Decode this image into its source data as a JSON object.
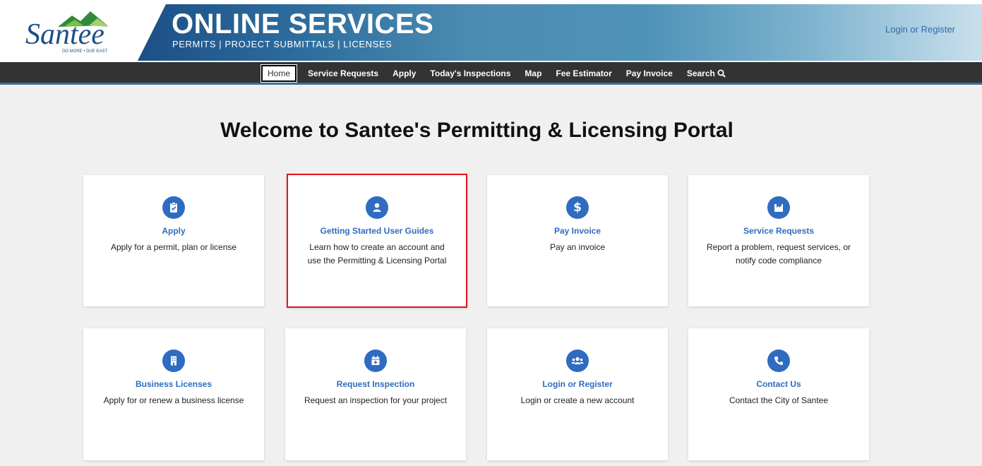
{
  "header": {
    "logo_text": "Santee",
    "logo_tagline": "DO MORE • DUE EAST",
    "banner_title": "ONLINE SERVICES",
    "banner_subtitle": "PERMITS | PROJECT SUBMITTALS | LICENSES",
    "login_link": "Login or Register"
  },
  "nav": {
    "items": [
      {
        "label": "Home",
        "active": true
      },
      {
        "label": "Service Requests"
      },
      {
        "label": "Apply"
      },
      {
        "label": "Today's Inspections"
      },
      {
        "label": "Map"
      },
      {
        "label": "Fee Estimator"
      },
      {
        "label": "Pay Invoice"
      },
      {
        "label": "Search"
      }
    ]
  },
  "page_title": "Welcome to Santee's Permitting & Licensing Portal",
  "cards": [
    {
      "title": "Apply",
      "desc": "Apply for a permit, plan or license",
      "icon": "clipboard-check-icon"
    },
    {
      "title": "Getting Started User Guides",
      "desc": "Learn how to create an account and use the Permitting & Licensing Portal",
      "icon": "user-icon"
    },
    {
      "title": "Pay Invoice",
      "desc": "Pay an invoice",
      "icon": "dollar-icon"
    },
    {
      "title": "Service Requests",
      "desc": "Report a problem, request services, or notify code compliance",
      "icon": "industry-icon"
    },
    {
      "title": "Business Licenses",
      "desc": "Apply for or renew a business license",
      "icon": "building-icon"
    },
    {
      "title": "Request Inspection",
      "desc": "Request an inspection for your project",
      "icon": "calendar-plus-icon"
    },
    {
      "title": "Login or Register",
      "desc": "Login or create a new account",
      "icon": "users-icon"
    },
    {
      "title": "Contact Us",
      "desc": "Contact the City of Santee",
      "icon": "phone-icon"
    }
  ],
  "colors": {
    "accent": "#2f6cc0",
    "nav_bg": "#333333",
    "highlight_border": "#e0141e"
  }
}
